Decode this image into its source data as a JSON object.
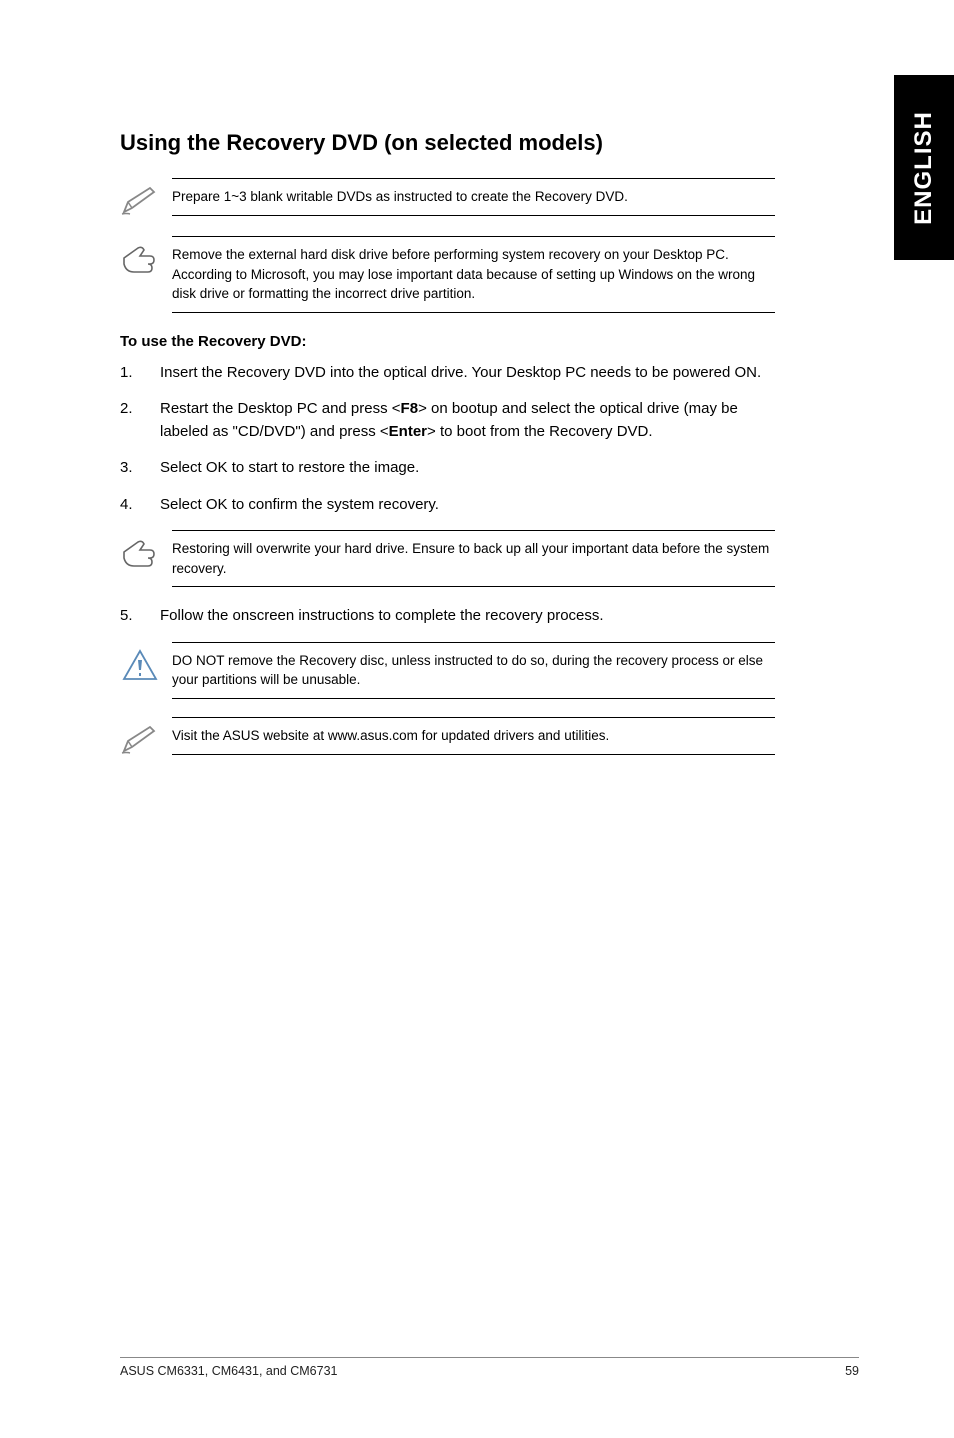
{
  "sideTab": "ENGLISH",
  "heading": "Using the Recovery DVD (on selected models)",
  "note1": "Prepare 1~3 blank writable DVDs as instructed to create the Recovery DVD.",
  "note2": "Remove the external hard disk drive before performing system recovery on your Desktop PC. According to Microsoft, you may lose important data because of setting up Windows on the wrong disk drive or formatting the incorrect drive partition.",
  "sectionLabel": "To use the Recovery DVD:",
  "steps": {
    "s1": {
      "num": "1.",
      "text_a": "Insert the Recovery DVD into the optical drive. Your Desktop PC needs to be powered ON."
    },
    "s2": {
      "num": "2.",
      "text_a": "Restart the Desktop PC and press <",
      "bold_a": "F8",
      "text_b": "> on bootup and select the optical drive (may be labeled as \"CD/DVD\") and press <",
      "bold_b": "Enter",
      "text_c": "> to boot from the Recovery DVD."
    },
    "s3": {
      "num": "3.",
      "text_a": "Select OK to start to restore the image."
    },
    "s4": {
      "num": "4.",
      "text_a": "Select OK to confirm the system recovery."
    },
    "s5": {
      "num": "5.",
      "text_a": "Follow the onscreen instructions to complete the recovery process."
    }
  },
  "note3": "Restoring will overwrite your hard drive. Ensure to back up all your important data before the system recovery.",
  "note4": "DO NOT remove the Recovery disc, unless instructed to do so, during the recovery process or else your partitions will be unusable.",
  "note5": "Visit the ASUS website at www.asus.com for updated drivers and utilities.",
  "footer": {
    "left": "ASUS CM6331, CM6431, and CM6731",
    "right": "59"
  }
}
